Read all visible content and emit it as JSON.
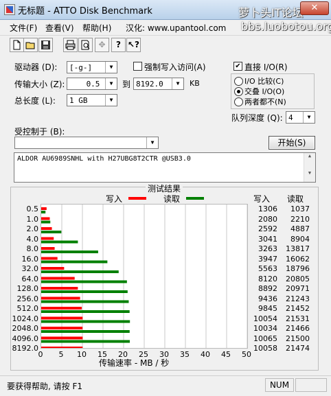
{
  "window": {
    "title": "无标题 - ATTO Disk Benchmark",
    "watermark_top": "萝卜头IT论坛",
    "watermark_url": "bbs.luobotou.org",
    "close_label": "✕"
  },
  "menu": [
    "文件(F)",
    "查看(V)",
    "帮助(H)",
    "汉化: www.upantool.com"
  ],
  "toolbar": {
    "icons": [
      "new-icon",
      "open-icon",
      "save-icon",
      "print-icon",
      "print-preview-icon",
      "move-icon",
      "help-icon",
      "context-help-icon"
    ]
  },
  "settings": {
    "drive_label": "驱动器 (D):",
    "drive_value": "[-g-]",
    "force_write_label": "强制写入访问(A)",
    "force_write_checked": false,
    "transfer_label": "传输大小 (Z):",
    "transfer_from": "0.5",
    "transfer_to_label": "到",
    "transfer_to": "8192.0",
    "transfer_unit": "KB",
    "length_label": "总长度 (L):",
    "length_value": "1 GB",
    "direct_io_label": "直接 I/O(R)",
    "direct_io_checked": true,
    "io_compare_label": "I/O 比较(C)",
    "overlapped_io_label": "交叠 I/O(O)",
    "neither_label": "两者都不(N)",
    "selected_io": "overlapped",
    "queue_label": "队列深度 (Q):",
    "queue_value": "4",
    "controlled_by_label": "受控制于 (B):",
    "controlled_by_value": "",
    "start_button": "开始(S)",
    "description": "ALDOR AU6989SNHL with H27UBG8T2CTR @USB3.0"
  },
  "results": {
    "title": "测试结果",
    "legend_write": "写入",
    "legend_read": "读取",
    "col_write": "写入",
    "col_read": "读取",
    "xlabel": "传输速率 - MB / 秒",
    "write_color": "#ff0000",
    "read_color": "#008000"
  },
  "chart_data": {
    "type": "bar",
    "orientation": "horizontal",
    "title": "测试结果",
    "xlabel": "传输速率 - MB / 秒",
    "ylabel": "",
    "xlim": [
      0,
      50
    ],
    "xticks": [
      0,
      5,
      10,
      15,
      20,
      25,
      30,
      35,
      40,
      45,
      50
    ],
    "categories": [
      "0.5",
      "1.0",
      "2.0",
      "4.0",
      "8.0",
      "16.0",
      "32.0",
      "64.0",
      "128.0",
      "256.0",
      "512.0",
      "1024.0",
      "2048.0",
      "4096.0",
      "8192.0"
    ],
    "series": [
      {
        "name": "写入",
        "color": "#ff0000",
        "values": [
          1306,
          2080,
          2592,
          3041,
          3263,
          3947,
          5563,
          8120,
          8892,
          9436,
          9845,
          10054,
          10034,
          10065,
          10058
        ]
      },
      {
        "name": "读取",
        "color": "#008000",
        "values": [
          1037,
          2210,
          4887,
          8904,
          13817,
          16062,
          18796,
          20805,
          20971,
          21243,
          21452,
          21531,
          21466,
          21500,
          21474
        ]
      }
    ],
    "value_unit_divisor": 1000,
    "grid": true,
    "legend": "top"
  },
  "status": {
    "help_text": "要获得帮助, 请按 F1",
    "num": "NUM"
  }
}
